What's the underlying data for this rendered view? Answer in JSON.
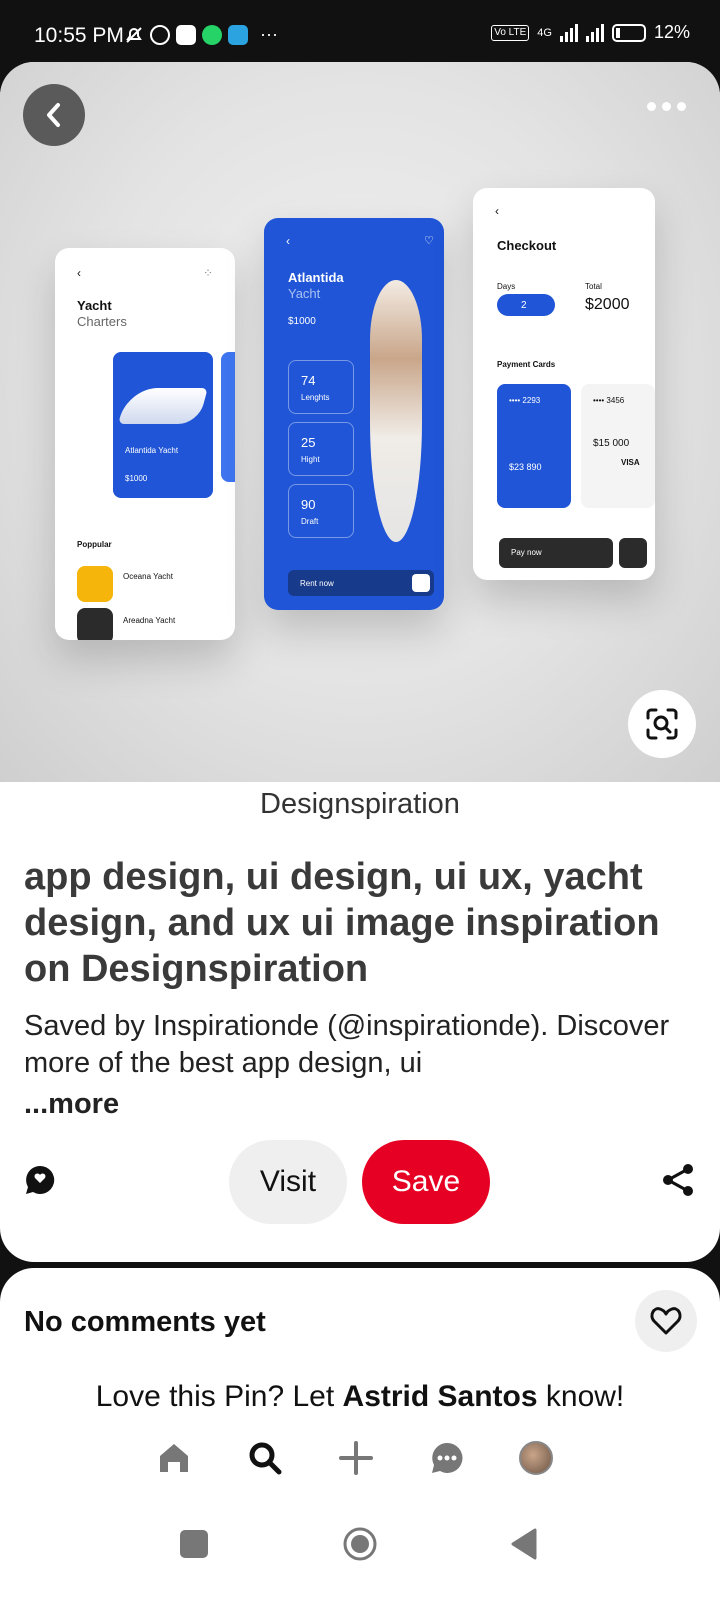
{
  "status_bar": {
    "time": "10:55 PM",
    "icons_left": [
      "muted-bell-icon",
      "alarm-icon",
      "phone-app-icon",
      "whatsapp-icon",
      "telegram-icon"
    ],
    "overflow": "···",
    "network": "4G",
    "lte_badge": "Vo LTE",
    "battery": "12%"
  },
  "pin": {
    "image": {
      "mock_left": {
        "title": "Yacht",
        "subtitle": "Charters",
        "card_title": "Atlantida Yacht",
        "card_price": "$1000",
        "section": "Poppular",
        "items": [
          "Oceana Yacht",
          "Areadna Yacht"
        ]
      },
      "mock_center": {
        "title": "Atlantida",
        "subtitle": "Yacht",
        "price": "$1000",
        "stats": [
          "74",
          "25",
          "90"
        ],
        "stat_labels": [
          "Lenghts",
          "Hight",
          "Draft"
        ],
        "cta": "Rent now"
      },
      "mock_right": {
        "title": "Checkout",
        "days_label": "Days",
        "days_value": "2",
        "total_label": "Total",
        "total_value": "$2000",
        "section": "Payment Cards",
        "card1_num": "•••• 2293",
        "card1_amount": "$23 890",
        "card2_num": "•••• 3456",
        "card2_amount": "$15 000",
        "card2_brand": "VISA",
        "cta": "Pay now"
      }
    },
    "source": "Designspiration",
    "title": "app design, ui design, ui ux, yacht design, and ux ui image inspiration on Designspiration",
    "description": "Saved by Inspirationde (@inspirationde). Discover more of the best app design, ui",
    "more_label": "...more",
    "visit_label": "Visit",
    "save_label": "Save"
  },
  "comments": {
    "empty_label": "No comments yet",
    "prompt_prefix": "Love this Pin? Let ",
    "prompt_name": "Astrid Santos",
    "prompt_suffix": " know!"
  },
  "bottom_nav": [
    "home-icon",
    "search-icon",
    "create-icon",
    "messages-icon",
    "profile-avatar"
  ],
  "colors": {
    "save_red": "#e60023",
    "accent_blue": "#1f55d6"
  }
}
